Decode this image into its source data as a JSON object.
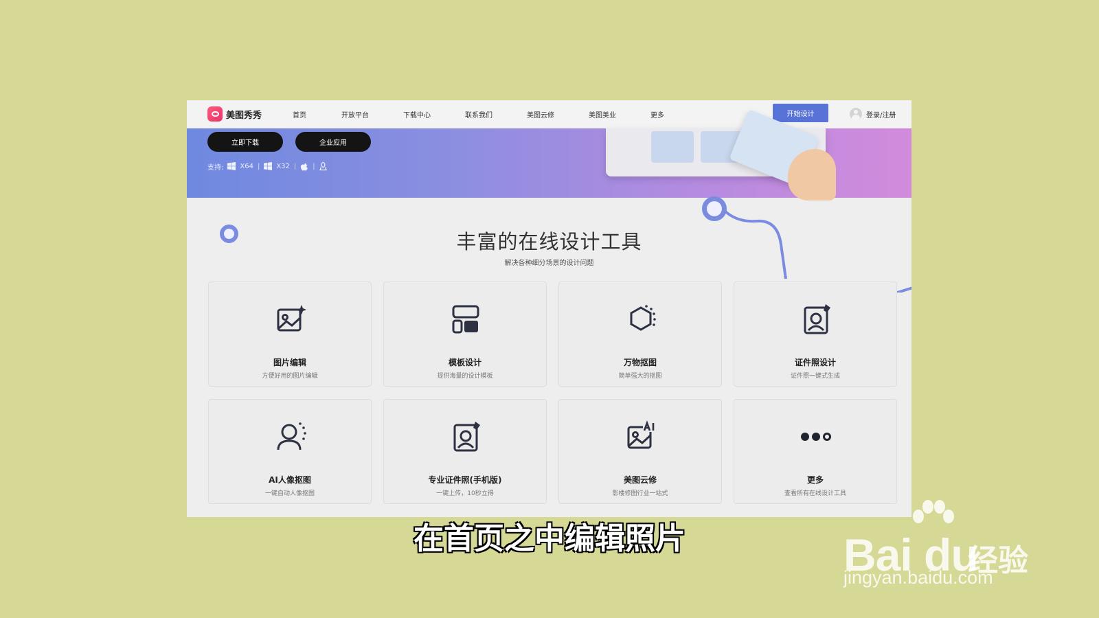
{
  "nav": {
    "logo_text": "美图秀秀",
    "items": [
      {
        "label": "首页"
      },
      {
        "label": "开放平台"
      },
      {
        "label": "下载中心"
      },
      {
        "label": "联系我们"
      },
      {
        "label": "美图云修"
      },
      {
        "label": "美图美业"
      },
      {
        "label": "更多"
      }
    ],
    "start_button": "开始设计",
    "login": "登录/注册"
  },
  "banner": {
    "download_button": "立即下载",
    "enterprise_button": "企业应用",
    "support_label": "支持:",
    "platforms": [
      {
        "icon": "windows-icon",
        "label": "X64"
      },
      {
        "icon": "windows-icon",
        "label": "X32"
      },
      {
        "icon": "apple-icon",
        "label": ""
      },
      {
        "icon": "linux-icon",
        "label": ""
      }
    ]
  },
  "section": {
    "title": "丰富的在线设计工具",
    "subtitle": "解决各种细分场景的设计问题"
  },
  "tools": [
    {
      "title": "图片编辑",
      "desc": "方便好用的图片编辑",
      "icon": "image-edit-icon"
    },
    {
      "title": "模板设计",
      "desc": "提供海量的设计模板",
      "icon": "template-icon"
    },
    {
      "title": "万物抠图",
      "desc": "简单强大的抠图",
      "icon": "cutout-icon"
    },
    {
      "title": "证件照设计",
      "desc": "证件照一键式生成",
      "icon": "id-photo-icon"
    },
    {
      "title": "AI人像抠图",
      "desc": "一键自动人像抠图",
      "icon": "portrait-cutout-icon"
    },
    {
      "title": "专业证件照(手机版)",
      "desc": "一键上传，10秒立得",
      "icon": "pro-id-photo-icon"
    },
    {
      "title": "美图云修",
      "desc": "影楼修图行业一站式",
      "icon": "ai-image-icon"
    },
    {
      "title": "更多",
      "desc": "查看所有在线设计工具",
      "icon": "more-icon"
    }
  ],
  "caption": "在首页之中编辑照片",
  "watermark": {
    "brand": "Bai du",
    "cn": "经验",
    "url": "jingyan.baidu.com"
  }
}
